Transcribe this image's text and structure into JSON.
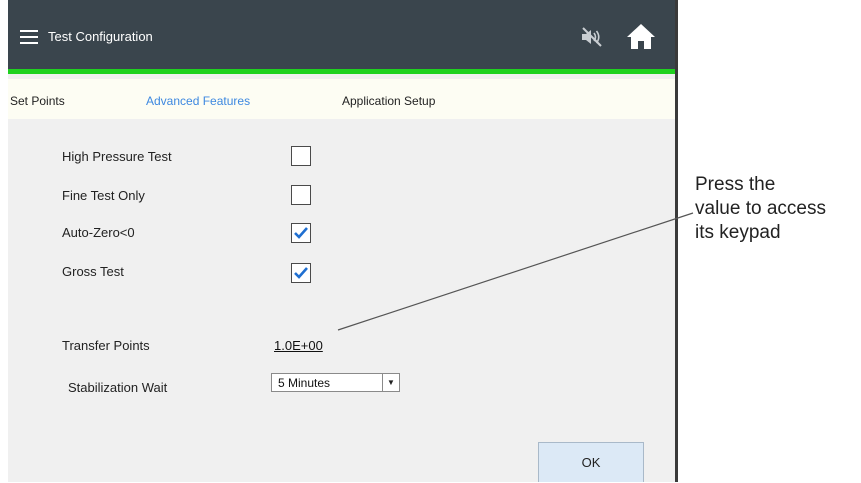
{
  "header": {
    "title": "Test Configuration",
    "menu_icon": "hamburger-menu-icon",
    "mute_icon": "speaker-muted-icon",
    "home_icon": "home-icon"
  },
  "tabs": [
    {
      "label": "Set Points",
      "active": false
    },
    {
      "label": "Advanced Features",
      "active": true
    },
    {
      "label": "Application Setup",
      "active": false
    }
  ],
  "options": [
    {
      "label": "High Pressure Test",
      "checked": false
    },
    {
      "label": "Fine Test Only",
      "checked": false
    },
    {
      "label": "Auto-Zero<0",
      "checked": true
    },
    {
      "label": "Gross Test",
      "checked": true
    }
  ],
  "transfer_points": {
    "label": "Transfer Points",
    "value": "1.0E+00"
  },
  "stabilization_wait": {
    "label": "Stabilization Wait",
    "selected": "5 Minutes",
    "arrow": "▼"
  },
  "ok_button": {
    "label": "OK"
  },
  "callout": {
    "lines": [
      "Press the",
      "value to access",
      "its keypad"
    ]
  },
  "colors": {
    "header_bg": "#3a454d",
    "accent_green": "#1fd11f",
    "active_tab": "#3d88e0",
    "check_blue": "#1f6fd1"
  }
}
